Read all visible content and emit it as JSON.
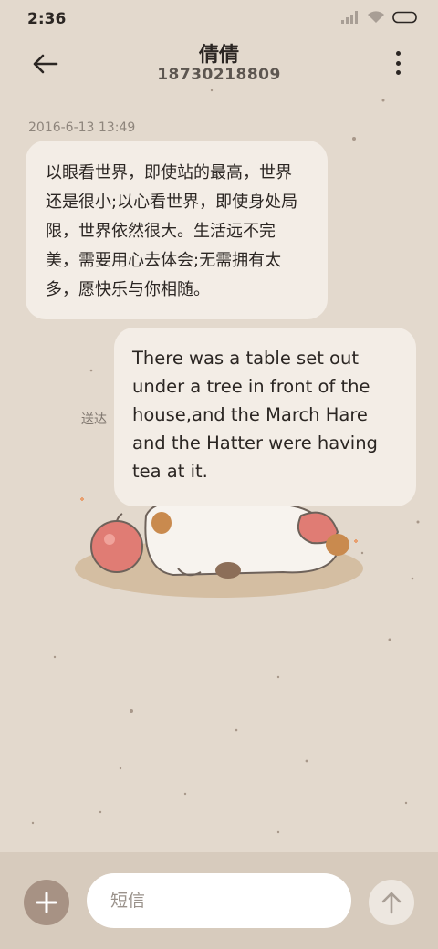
{
  "status_bar": {
    "time": "2:36"
  },
  "header": {
    "contact_name": "倩倩",
    "contact_number": "18730218809"
  },
  "conversation": {
    "timestamp": "2016-6-13 13:49",
    "messages": [
      {
        "direction": "incoming",
        "text": "以眼看世界，即使站的最高，世界还是很小;以心看世界，即使身处局限，世界依然很大。生活远不完美，需要用心去体会;无需拥有太多，愿快乐与你相随。"
      },
      {
        "direction": "outgoing",
        "text": "There was a table set out under a tree in front of the house,and the March Hare and the Hatter were having tea at it.",
        "status": "送达"
      }
    ]
  },
  "input_bar": {
    "placeholder": "短信"
  },
  "colors": {
    "background": "#e3d9cd",
    "bubble": "#f3ede6",
    "input_bar": "#d7cbbd",
    "accent": "#a79284"
  }
}
